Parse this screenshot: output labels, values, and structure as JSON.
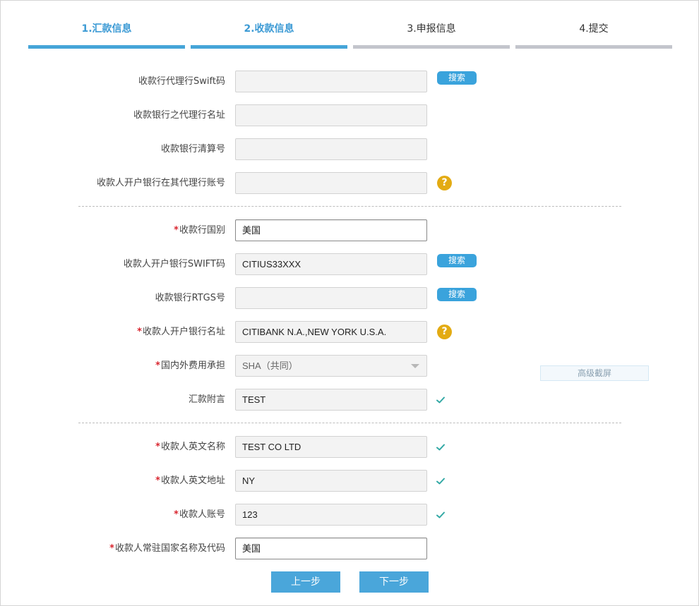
{
  "steps": [
    {
      "label": "1.汇款信息",
      "state": "active"
    },
    {
      "label": "2.收款信息",
      "state": "active"
    },
    {
      "label": "3.申报信息",
      "state": "inactive"
    },
    {
      "label": "4.提交",
      "state": "inactive"
    }
  ],
  "colors": {
    "accent": "#46a5d8",
    "inactive_bar": "#c3c5cc",
    "required": "#d9262f",
    "help": "#e3ab13",
    "check": "#33a9a5"
  },
  "form": {
    "search_label": "搜索",
    "required_mark": "*",
    "help_glyph": "?",
    "rows": [
      {
        "label": "收款行代理行Swift码",
        "required": false,
        "value": "",
        "style": "grey",
        "action": "search"
      },
      {
        "label": "收款银行之代理行名址",
        "required": false,
        "value": "",
        "style": "grey",
        "action": ""
      },
      {
        "label": "收款银行清算号",
        "required": false,
        "value": "",
        "style": "grey",
        "action": ""
      },
      {
        "label": "收款人开户银行在其代理行账号",
        "required": false,
        "value": "",
        "style": "grey",
        "action": "help"
      },
      {
        "label": "收款行国别",
        "required": true,
        "value": "美国",
        "style": "white",
        "action": ""
      },
      {
        "label": "收款人开户银行SWIFT码",
        "required": false,
        "value": "CITIUS33XXX",
        "style": "grey",
        "action": "search"
      },
      {
        "label": "收款银行RTGS号",
        "required": false,
        "value": "",
        "style": "grey",
        "action": "search"
      },
      {
        "label": "收款人开户银行名址",
        "required": true,
        "value": "CITIBANK N.A.,NEW YORK U.S.A.",
        "style": "grey",
        "action": "help"
      },
      {
        "label": "国内外费用承担",
        "required": true,
        "value": "SHA（共同）",
        "style": "select",
        "action": ""
      },
      {
        "label": "汇款附言",
        "required": false,
        "value": "TEST",
        "style": "grey",
        "action": "check"
      },
      {
        "label": "收款人英文名称",
        "required": true,
        "value": "TEST CO LTD",
        "style": "grey",
        "action": "check"
      },
      {
        "label": "收款人英文地址",
        "required": true,
        "value": "NY",
        "style": "grey",
        "action": "check"
      },
      {
        "label": "收款人账号",
        "required": true,
        "value": "123",
        "style": "grey",
        "action": "check"
      },
      {
        "label": "收款人常驻国家名称及代码",
        "required": true,
        "value": "美国",
        "style": "white",
        "action": ""
      }
    ]
  },
  "advanced_capture": "高级截屏",
  "buttons": {
    "prev": "上一步",
    "next": "下一步"
  }
}
